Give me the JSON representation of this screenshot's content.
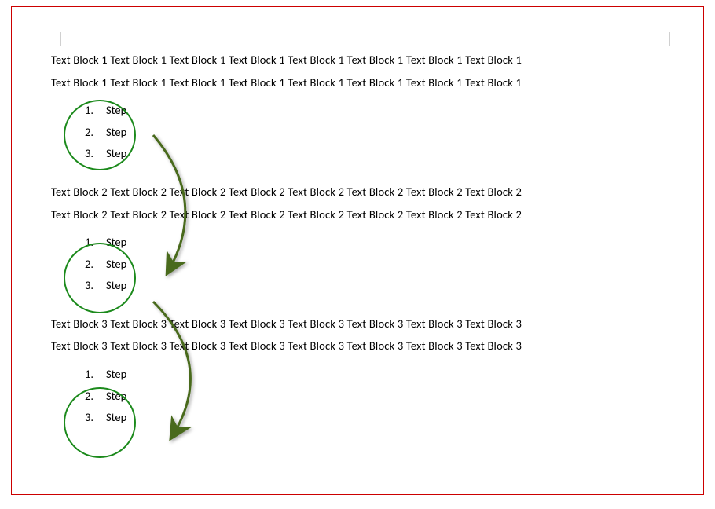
{
  "blocks": [
    {
      "para_line1": "Text Block 1 Text Block 1 Text Block 1 Text Block 1 Text Block 1 Text Block 1 Text Block 1 Text Block 1",
      "para_line2": "Text Block 1 Text Block 1 Text Block 1 Text Block 1 Text Block 1 Text Block 1 Text Block 1 Text Block 1",
      "steps": [
        {
          "num": "1.",
          "label": "Step"
        },
        {
          "num": "2.",
          "label": "Step"
        },
        {
          "num": "3.",
          "label": "Step"
        }
      ]
    },
    {
      "para_line1": "Text Block 2 Text Block 2 Text Block 2 Text Block 2 Text Block 2 Text Block 2 Text Block 2 Text Block 2",
      "para_line2": "Text Block 2 Text Block 2 Text Block 2 Text Block 2 Text Block 2 Text Block 2 Text Block 2 Text Block 2",
      "steps": [
        {
          "num": "1.",
          "label": "Step"
        },
        {
          "num": "2.",
          "label": "Step"
        },
        {
          "num": "3.",
          "label": "Step"
        }
      ]
    },
    {
      "para_line1": "Text Block 3 Text Block 3 Text Block 3 Text Block 3 Text Block 3 Text Block 3 Text Block 3 Text Block 3",
      "para_line2": "Text Block 3 Text Block 3 Text Block 3 Text Block 3 Text Block 3 Text Block 3 Text Block 3 Text Block 3",
      "steps": [
        {
          "num": "1.",
          "label": "Step"
        },
        {
          "num": "2.",
          "label": "Step"
        },
        {
          "num": "3.",
          "label": "Step"
        }
      ]
    }
  ],
  "shapes": {
    "circle_color": "#1c8a1c",
    "arrow_color": "#4a6b1f"
  }
}
